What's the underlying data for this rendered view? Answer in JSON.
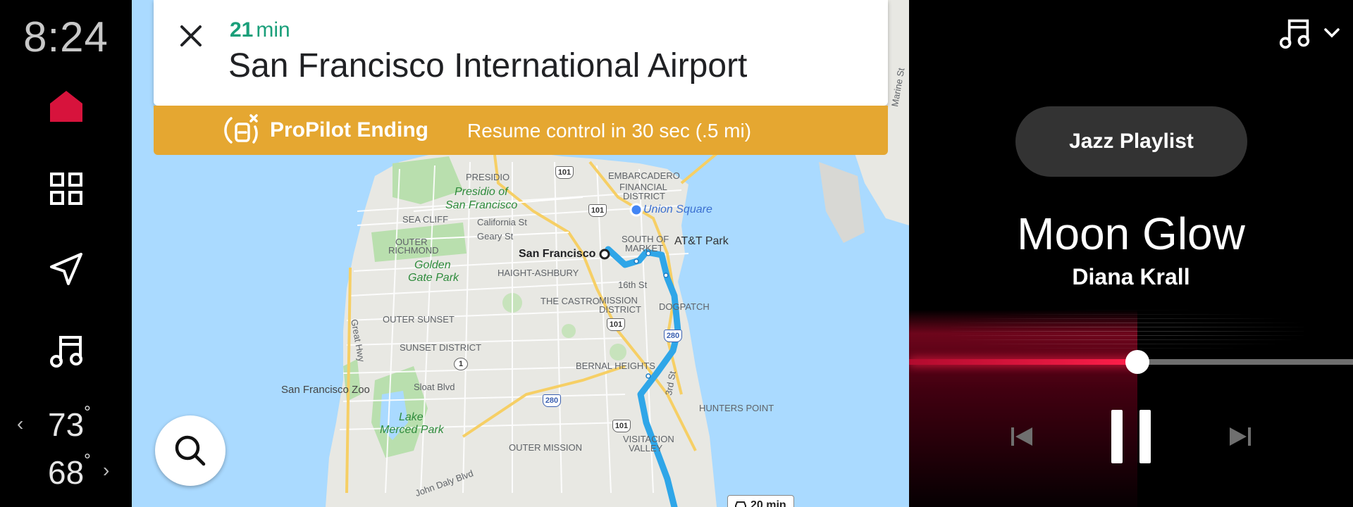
{
  "status": {
    "time": "8:24"
  },
  "rail": {
    "items": [
      {
        "name": "home",
        "icon": "home-icon"
      },
      {
        "name": "apps",
        "icon": "grid-icon"
      },
      {
        "name": "navigation",
        "icon": "navigation-arrow-icon"
      },
      {
        "name": "music",
        "icon": "music-note-icon"
      }
    ],
    "temp_left": "73",
    "temp_right": "68",
    "degree": "°"
  },
  "navigation": {
    "eta_value": "21",
    "eta_unit": "min",
    "destination": "San Francisco International Airport",
    "propilot": {
      "title": "ProPilot Ending",
      "message": "Resume control in 30 sec (.5 mi)"
    },
    "route_time": "20 min"
  },
  "map": {
    "labels": {
      "presidio": "PRESIDIO",
      "presidio_park": "Presidio of",
      "presidio_park2": "San Francisco",
      "sea_cliff": "SEA CLIFF",
      "outer_richmond": "OUTER",
      "outer_richmond2": "RICHMOND",
      "golden_gate": "Golden",
      "golden_gate2": "Gate Park",
      "california": "California St",
      "geary": "Geary St",
      "haight": "HAIGHT-ASHBURY",
      "san_francisco": "San Francisco",
      "embarcadero": "EMBARCADERO",
      "financial": "FINANCIAL",
      "financial2": "DISTRICT",
      "union_square": "Union Square",
      "south_of_market": "SOUTH OF",
      "south_of_market2": "MARKET",
      "att_park": "AT&T Park",
      "sixteenth": "16th St",
      "castro": "THE CASTRO",
      "mission": "MISSION",
      "mission2": "DISTRICT",
      "dogpatch": "DOGPATCH",
      "outer_sunset": "OUTER SUNSET",
      "sunset": "SUNSET DISTRICT",
      "great_hwy": "Great Hwy",
      "bernal": "BERNAL HEIGHTS",
      "zoo": "San Francisco Zoo",
      "sloat": "Sloat Blvd",
      "lake_merced": "Lake",
      "lake_merced2": "Merced Park",
      "hunters_point": "HUNTERS POINT",
      "third_st": "3rd St",
      "outer_mission": "OUTER MISSION",
      "visitacion": "VISITACION",
      "visitacion2": "VALLEY",
      "john_daly": "John Daly Blvd",
      "marine_st": "Marine St"
    },
    "shields": {
      "us101": "101",
      "i280": "280",
      "ca1": "1"
    }
  },
  "media": {
    "source_icon": "music-note-icon",
    "playlist": "Jazz Playlist",
    "song": "Moon Glow",
    "artist": "Diana Krall",
    "progress": 0.515,
    "accent": "#ff1f4a"
  }
}
